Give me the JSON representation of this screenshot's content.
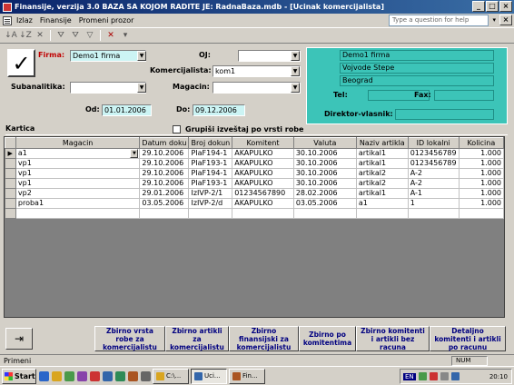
{
  "window": {
    "title": "Finansije, verzija 3.0     BAZA SA KOJOM RADITE JE: RadnaBaza.mdb - [Ucinak komercijalista]"
  },
  "menu": {
    "items": [
      "Izlaz",
      "Finansije",
      "Promeni prozor"
    ],
    "help_placeholder": "Type a question for help"
  },
  "form": {
    "firma_label": "Firma:",
    "firma_value": "Demo1 firma",
    "oj_label": "OJ:",
    "oj_value": "",
    "komercijalista_label": "Komercijalista:",
    "komercijalista_value": "kom1",
    "subanalitika_label": "Subanalitika:",
    "subanalitika_value": "",
    "magacin_label": "Magacin:",
    "magacin_value": "",
    "od_label": "Od:",
    "od_value": "01.01.2006",
    "do_label": "Do:",
    "do_value": "09.12.2006"
  },
  "company": {
    "name": "Demo1 firma",
    "address": "Vojvode Stepe",
    "city": "Beograd",
    "tel_label": "Tel:",
    "fax_label": "Fax:",
    "director_label": "Direktor-vlasnik:"
  },
  "kartica": {
    "label": "Kartica",
    "group_checkbox_label": "Grupiši izveštaj po vrsti robe"
  },
  "grid": {
    "columns": [
      "Magacin",
      "Datum doku",
      "Broj dokun",
      "Komitent",
      "Valuta",
      "Naziv artikla",
      "ID lokalni",
      "Kolicina"
    ],
    "rows": [
      [
        "a1",
        "29.10.2006",
        "PIaF194-1",
        "AKAPULKO",
        "30.10.2006",
        "artikal1",
        "0123456789",
        "1.000"
      ],
      [
        "vp1",
        "29.10.2006",
        "PIaF193-1",
        "AKAPULKO",
        "30.10.2006",
        "artikal1",
        "0123456789",
        "1.000"
      ],
      [
        "vp1",
        "29.10.2006",
        "PIaF194-1",
        "AKAPULKO",
        "30.10.2006",
        "artikal2",
        "A-2",
        "1.000"
      ],
      [
        "vp1",
        "29.10.2006",
        "PIaF193-1",
        "AKAPULKO",
        "30.10.2006",
        "artikal2",
        "A-2",
        "1.000"
      ],
      [
        "vp2",
        "29.01.2006",
        "IzIVP-2/1",
        "01234567890",
        "28.02.2006",
        "artikal1",
        "A-1",
        "1.000"
      ],
      [
        "proba1",
        "03.05.2006",
        "IzIVP-2/d",
        "AKAPULKO",
        "03.05.2006",
        "a1",
        "1",
        "1.000"
      ]
    ]
  },
  "buttons": {
    "b1": "Zbirno vrsta robe za komercijalistu",
    "b2": "Zbirno artikli za komercijalistu",
    "b3": "Zbirno finansijski za komercijalistu",
    "b4": "Zbirno po komitentima",
    "b5": "Zbirno komitenti i artikli bez racuna",
    "b6": "Detaljno komitenti i artikli po racunu"
  },
  "status": {
    "text": "Primeni",
    "num": "NUM"
  },
  "taskbar": {
    "start": "Start",
    "items": [
      "C:\\...",
      "Uci...",
      "Fin..."
    ],
    "lang": "EN",
    "clock": "20:10"
  }
}
